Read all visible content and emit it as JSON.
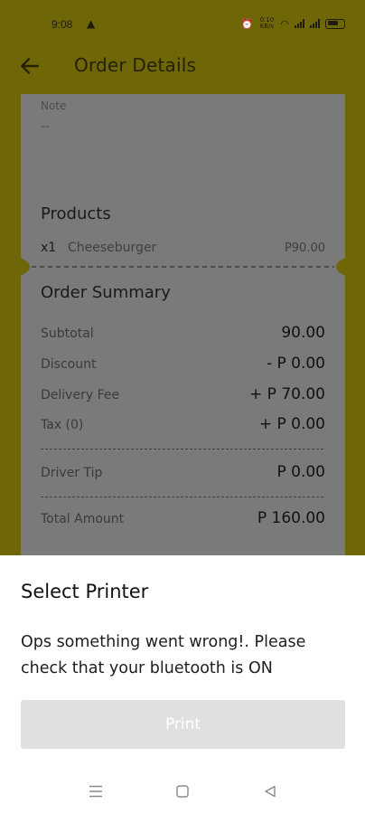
{
  "status_bar": {
    "time": "9:08",
    "alert_icon": "warning-icon",
    "network_speed": "0.10 KB/s",
    "icons": [
      "alarm-icon",
      "wifi-icon",
      "signal-icon",
      "signal-icon",
      "battery-icon"
    ]
  },
  "app_bar": {
    "title": "Order Details",
    "back_icon": "arrow-left-icon"
  },
  "note": {
    "label": "Note",
    "value": "--"
  },
  "products": {
    "title": "Products",
    "items": [
      {
        "qty": "x1",
        "name": "Cheeseburger",
        "price": "P90.00"
      }
    ]
  },
  "summary": {
    "title": "Order Summary",
    "subtotal_label": "Subtotal",
    "subtotal_value": "90.00",
    "discount_label": "Discount",
    "discount_value": "- P 0.00",
    "delivery_label": "Delivery Fee",
    "delivery_value": "+ P 70.00",
    "tax_label": "Tax (0)",
    "tax_value": "+ P 0.00",
    "tip_label": "Driver Tip",
    "tip_value": "P 0.00",
    "total_label": "Total Amount",
    "total_value": "P 160.00"
  },
  "sheet": {
    "title": "Select Printer",
    "message": "Ops something went wrong!. Please check that your bluetooth is ON",
    "print_label": "Print"
  },
  "colors": {
    "brand_yellow": "#e5d40a",
    "scrim_tinted": "#6e6607",
    "card_gray": "#7a7a7a",
    "disabled_button": "#e0e0e0"
  },
  "nav_bar": {
    "icons": [
      "menu-icon",
      "home-square-icon",
      "back-triangle-icon"
    ]
  }
}
